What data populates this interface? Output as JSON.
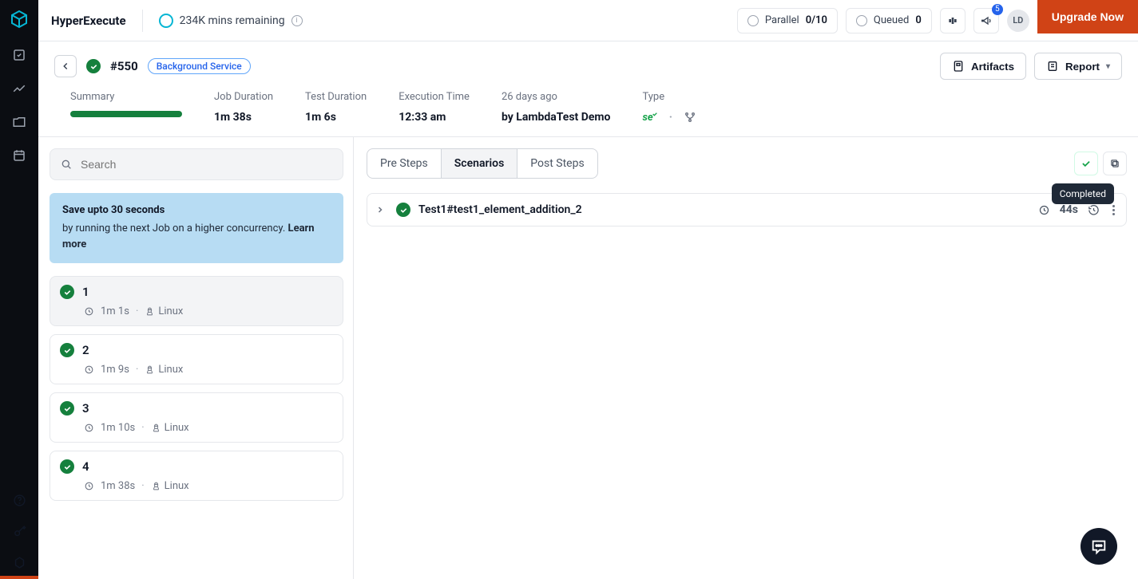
{
  "header": {
    "brand": "HyperExecute",
    "mins_remaining": "234K mins remaining",
    "parallel_label": "Parallel",
    "parallel_value": "0/10",
    "queued_label": "Queued",
    "queued_value": "0",
    "notif_badge": "5",
    "avatar_initials": "LD",
    "upgrade": "Upgrade Now"
  },
  "job": {
    "id": "#550",
    "tag": "Background Service",
    "artifacts_btn": "Artifacts",
    "report_btn": "Report"
  },
  "metrics": {
    "summary_label": "Summary",
    "job_duration_label": "Job Duration",
    "job_duration_value": "1m 38s",
    "test_duration_label": "Test Duration",
    "test_duration_value": "1m 6s",
    "exec_time_label": "Execution Time",
    "exec_time_value": "12:33 am",
    "when_label": "26 days ago",
    "when_value": "by LambdaTest Demo",
    "type_label": "Type"
  },
  "search": {
    "placeholder": "Search"
  },
  "tip": {
    "title": "Save upto 30 seconds",
    "body_a": "by running the next Job on a higher concurrency. ",
    "learn": "Learn more"
  },
  "tasks": [
    {
      "num": "1",
      "dur": "1m 1s",
      "os": "Linux"
    },
    {
      "num": "2",
      "dur": "1m 9s",
      "os": "Linux"
    },
    {
      "num": "3",
      "dur": "1m 10s",
      "os": "Linux"
    },
    {
      "num": "4",
      "dur": "1m 38s",
      "os": "Linux"
    }
  ],
  "steps": {
    "tab_pre": "Pre Steps",
    "tab_scen": "Scenarios",
    "tab_post": "Post Steps",
    "tooltip": "Completed"
  },
  "test": {
    "name": "Test1#test1_element_addition_2",
    "duration": "44s"
  }
}
